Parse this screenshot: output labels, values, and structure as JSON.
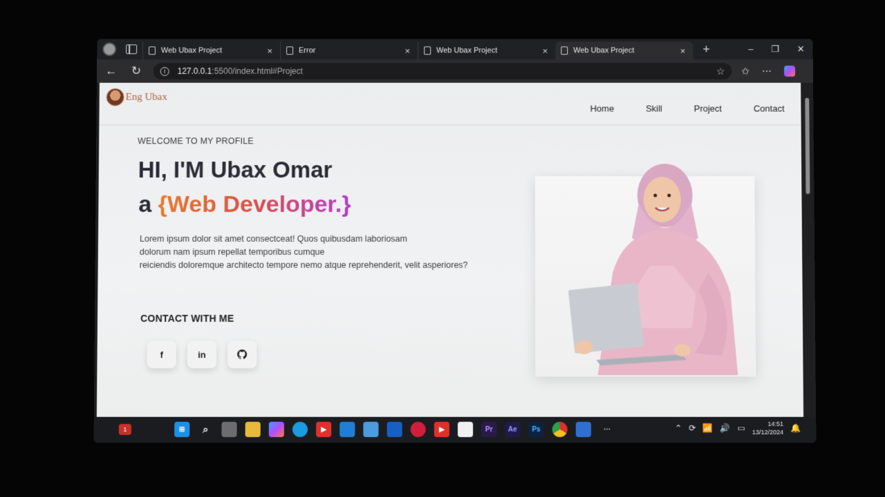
{
  "browser": {
    "tabs": [
      {
        "title": "Web Ubax Project",
        "active": false
      },
      {
        "title": "Error",
        "active": false
      },
      {
        "title": "Web Ubax Project",
        "active": false
      },
      {
        "title": "Web Ubax Project",
        "active": true
      }
    ],
    "tab_close_glyph": "×",
    "new_tab_glyph": "+",
    "window_controls": {
      "minimize": "–",
      "restore": "❐",
      "close": "✕"
    },
    "url_host": "127.0.0.1",
    "url_rest": ":5500/index.html#Project",
    "icons": [
      "back-icon",
      "refresh-icon",
      "info-icon",
      "star-icon",
      "favorites-icon",
      "more-icon",
      "copilot-icon"
    ]
  },
  "site": {
    "logo_text": "Eng Ubax",
    "nav": [
      "Home",
      "Skill",
      "Project",
      "Contact"
    ],
    "welcome": "WELCOME TO MY PROFILE",
    "hero_name": "HI, I'M Ubax Omar",
    "hero_prefix": "a ",
    "hero_role": "{Web Developer.}",
    "bio_line1": "Lorem ipsum dolor sit amet consectceat! Quos quibusdam laboriosam",
    "bio_line2": "dolorum nam ipsum repellat temporibus cumque",
    "bio_line3": "reiciendis doloremque architecto tempore nemo atque reprehenderit, velit asperiores?",
    "contact_title": "CONTACT WITH ME",
    "socials": [
      {
        "name": "facebook-icon",
        "glyph": "f"
      },
      {
        "name": "linkedin-icon",
        "glyph": "in"
      },
      {
        "name": "github-icon",
        "glyph": ""
      }
    ]
  },
  "taskbar": {
    "notification_count": "1",
    "apps": [
      "windows-start-icon",
      "search-icon",
      "task-view-icon",
      "file-explorer-icon",
      "copilot-icon",
      "edge-icon",
      "youtube-icon",
      "vscode-icon",
      "store-icon",
      "outlook-icon",
      "pinterest-icon",
      "youtube-icon",
      "notepad-icon",
      "premiere-icon",
      "after-effects-icon",
      "photoshop-icon",
      "chrome-icon",
      "virtualbox-icon",
      "more-icon"
    ],
    "app_labels": {
      "premiere": "Pr",
      "after_effects": "Ae",
      "photoshop": "Ps"
    },
    "time": "14:51",
    "date": "13/12/2024"
  },
  "colors": {
    "role_gradient": [
      "#e87a2a",
      "#d8504a",
      "#b33ad0"
    ],
    "heading": "#2b2b35",
    "browser_chrome": "#202124"
  }
}
